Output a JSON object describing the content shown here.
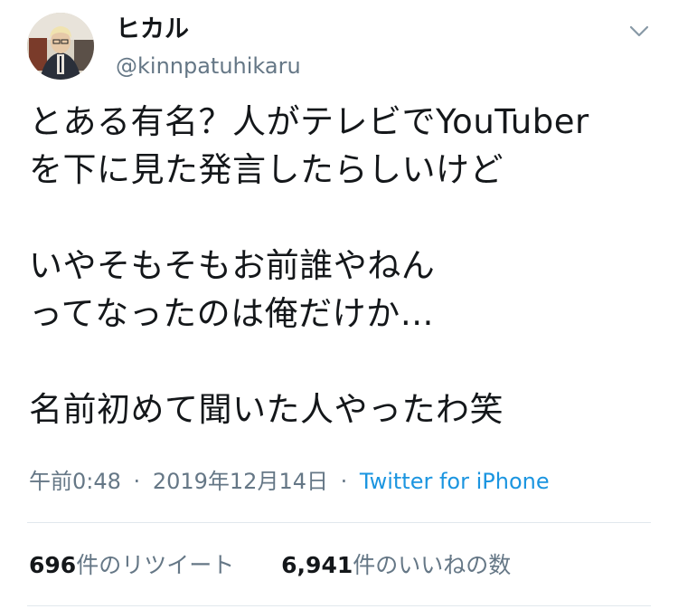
{
  "user": {
    "display_name": "ヒカル",
    "handle": "@kinnpatuhikaru"
  },
  "icons": {
    "avatar": "profile-photo",
    "menu": "chevron-down-icon"
  },
  "tweet": {
    "lines": [
      "とある有名？人がテレビでYouTuber",
      "を下に見た発言したらしいけど",
      "",
      "いやそもそもお前誰やねん",
      "ってなったのは俺だけか…",
      "",
      "名前初めて聞いた人やったわ笑"
    ],
    "time": "午前0:48",
    "separator": "·",
    "date": "2019年12月14日",
    "source": "Twitter for iPhone"
  },
  "stats": {
    "retweets": {
      "count": "696",
      "label": "件のリツイート"
    },
    "likes": {
      "count": "6,941",
      "label": "件のいいねの数"
    }
  },
  "colors": {
    "text": "#14171a",
    "secondary": "#657786",
    "link": "#1b95e0",
    "divider": "#e1e8ed"
  }
}
